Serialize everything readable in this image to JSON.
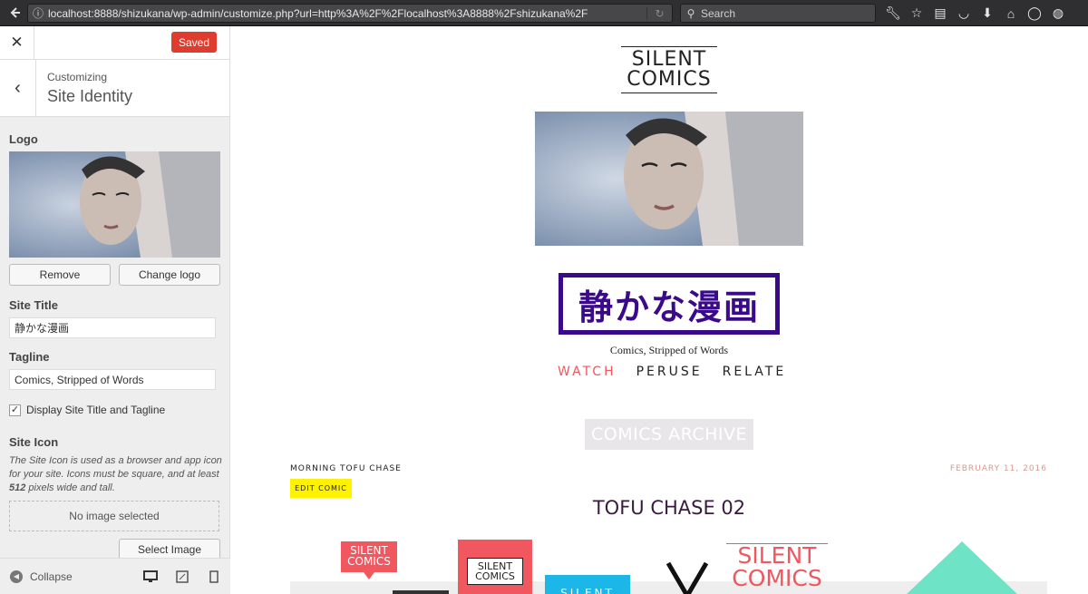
{
  "browser": {
    "url": "localhost:8888/shizukana/wp-admin/customize.php?url=http%3A%2F%2Flocalhost%3A8888%2Fshizukana%2F",
    "search_placeholder": "Search"
  },
  "customizer": {
    "saved_label": "Saved",
    "breadcrumb": "Customizing",
    "section_title": "Site Identity",
    "logo_label": "Logo",
    "remove_label": "Remove",
    "change_logo_label": "Change logo",
    "site_title_label": "Site Title",
    "site_title_value": "静かな漫画",
    "tagline_label": "Tagline",
    "tagline_value": "Comics, Stripped of Words",
    "display_checkbox_label": "Display Site Title and Tagline",
    "display_checked": true,
    "site_icon_label": "Site Icon",
    "site_icon_desc_1": "The Site Icon is used as a browser and app icon for your site. Icons must be square, and at least ",
    "site_icon_desc_bold": "512",
    "site_icon_desc_2": " pixels wide and tall.",
    "no_image_label": "No image selected",
    "select_image_label": "Select Image",
    "collapse_label": "Collapse"
  },
  "preview": {
    "logo_line1": "SILENT",
    "logo_line2": "COMICS",
    "site_title": "静かな漫画",
    "tagline": "Comics, Stripped of Words",
    "menu": [
      "WATCH",
      "PERUSE",
      "RELATE"
    ],
    "archive_heading": "COMICS ARCHIVE",
    "post_category": "MORNING TOFU CHASE",
    "post_date": "FEBRUARY 11, 2016",
    "edit_label": "EDIT COMIC",
    "post_title": "TOFU CHASE 02",
    "thumb_logo_line1": "SILENT",
    "thumb_logo_line2": "COMICS",
    "thumb_partial": "SILENT"
  },
  "colors": {
    "saved_red": "#dd3c2f",
    "title_purple": "#3a0a8a",
    "menu_active": "#f0575f",
    "edit_yellow": "#fff200",
    "date_color": "#d89a90"
  }
}
